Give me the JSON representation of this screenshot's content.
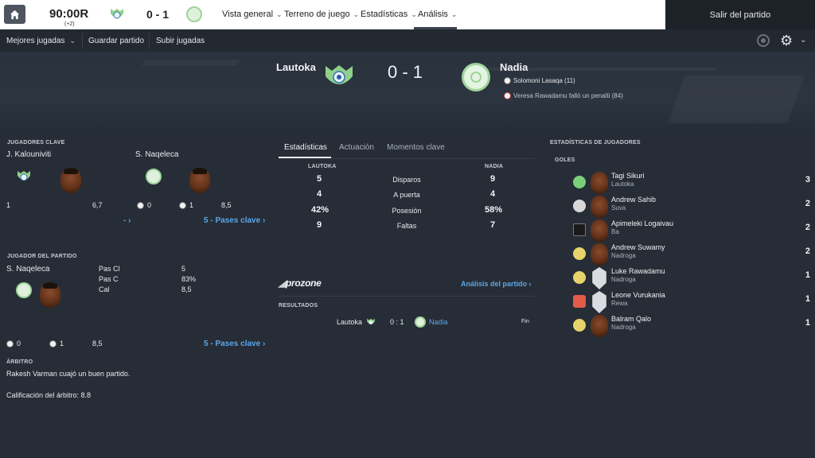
{
  "top": {
    "clock": "90:00R",
    "added_time": "(+2)",
    "score": "0 - 1",
    "nav": [
      "Vista general",
      "Terreno de juego",
      "Estadísticas",
      "Análisis"
    ],
    "exit": "Salir del partido"
  },
  "sub": {
    "items": [
      "Mejores jugadas",
      "Guardar partido",
      "Subir jugadas"
    ]
  },
  "hero": {
    "home_team": "Lautoka",
    "away_team": "Nadia",
    "score": "0 - 1",
    "scorer": "Solomoni Lasaqa (11)",
    "missed_penalty": "Veresa Rawadamu falló un penalti (84)"
  },
  "key_players": {
    "title": "JUGADORES CLAVE",
    "home_name": "J. Kalouniviti",
    "away_name": "S. Naqeleca",
    "home_stat1": "1",
    "home_rating": "6,7",
    "away_goals": "0",
    "away_assists": "1",
    "away_rating": "8,5",
    "home_link": "- ›",
    "away_link": "5 - Pases clave ›"
  },
  "motm": {
    "title": "JUGADOR DEL PARTIDO",
    "name": "S. Naqeleca",
    "stats": [
      {
        "label": "Pas Cl",
        "value": "5"
      },
      {
        "label": "Pas C",
        "value": "83%"
      },
      {
        "label": "Cal",
        "value": "8,5"
      }
    ],
    "goals": "0",
    "assists": "1",
    "rating": "8,5",
    "link": "5 - Pases clave ›"
  },
  "referee": {
    "title": "ÁRBITRO",
    "comment": "Rakesh Varman cuajó un buen partido.",
    "rating": "Calificación del árbitro: 8.8"
  },
  "tabs": [
    "Estadísticas",
    "Actuación",
    "Momentos clave"
  ],
  "stats": {
    "home_label": "LAUTOKA",
    "away_label": "NADIA",
    "rows": [
      {
        "label": "Disparos",
        "home": "5",
        "away": "9"
      },
      {
        "label": "A puerta",
        "home": "4",
        "away": "4"
      },
      {
        "label": "Posesión",
        "home": "42%",
        "away": "58%"
      },
      {
        "label": "Faltas",
        "home": "9",
        "away": "7"
      }
    ]
  },
  "prozone": {
    "brand": "prozone",
    "link": "Análisis del partido ›"
  },
  "results": {
    "title": "RESULTADOS",
    "home": "Lautoka",
    "score": "0 : 1",
    "away": "Nadia",
    "status": "Fin"
  },
  "player_stats": {
    "title": "ESTADÍSTICAS DE JUGADORES",
    "sub": "GOLES",
    "rows": [
      {
        "name": "Tagi Sikuri",
        "team": "Lautoka",
        "goals": "3",
        "crest": "#7ad07a",
        "sil": false
      },
      {
        "name": "Andrew Sahib",
        "team": "Suva",
        "goals": "2",
        "crest": "#d8d8d8",
        "sil": false
      },
      {
        "name": "Apimeleki Logaivau",
        "team": "Ba",
        "goals": "2",
        "crest": "#1b1b1b",
        "sil": false
      },
      {
        "name": "Andrew Suwamy",
        "team": "Nadroga",
        "goals": "2",
        "crest": "#e6d36a",
        "sil": false
      },
      {
        "name": "Luke Rawadamu",
        "team": "Nadroga",
        "goals": "1",
        "crest": "#e6d36a",
        "sil": true
      },
      {
        "name": "Leone Vurukania",
        "team": "Rewa",
        "goals": "1",
        "crest": "#e35b4b",
        "sil": true
      },
      {
        "name": "Balram Qalo",
        "team": "Nadroga",
        "goals": "1",
        "crest": "#e6d36a",
        "sil": false
      }
    ]
  }
}
